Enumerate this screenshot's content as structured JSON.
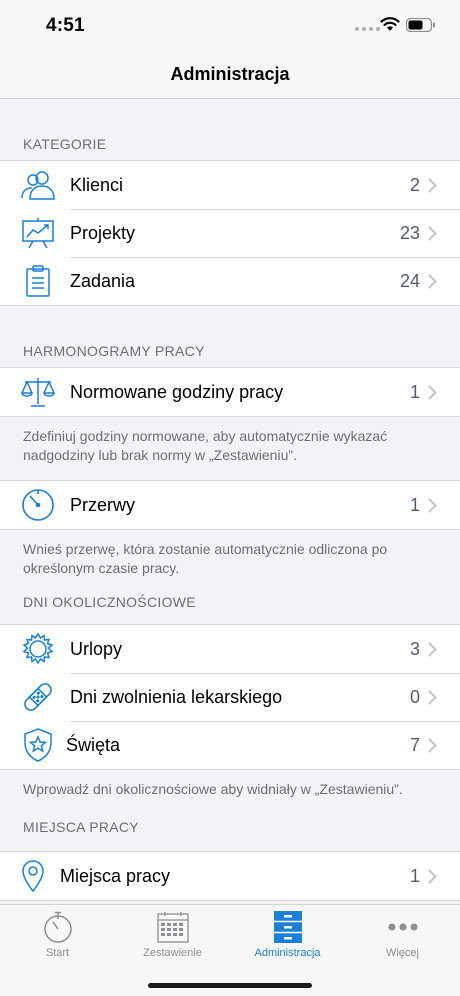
{
  "status_bar": {
    "time": "4:51"
  },
  "nav": {
    "title": "Administracja"
  },
  "sections": {
    "kategorie": {
      "header": "KATEGORIE",
      "items": [
        {
          "label": "Klienci",
          "value": "2",
          "icon": "users-icon"
        },
        {
          "label": "Projekty",
          "value": "23",
          "icon": "presentation-chart-icon"
        },
        {
          "label": "Zadania",
          "value": "24",
          "icon": "clipboard-icon"
        }
      ]
    },
    "harmonogramy": {
      "header": "HARMONOGRAMY PRACY",
      "normowane": {
        "label": "Normowane godziny pracy",
        "value": "1",
        "icon": "scales-icon"
      },
      "normowane_footer": "Zdefiniuj godziny normowane, aby automatycznie wykazać nadgodziny lub brak normy w „Zestawieniu”.",
      "przerwy": {
        "label": "Przerwy",
        "value": "1",
        "icon": "timer-icon"
      },
      "przerwy_footer": "Wnieś przerwę, która zostanie automatycznie odliczona po określonym czasie pracy."
    },
    "dni": {
      "header": "DNI OKOLICZNOŚCIOWE",
      "items": [
        {
          "label": "Urlopy",
          "value": "3",
          "icon": "sun-icon"
        },
        {
          "label": "Dni zwolnienia lekarskiego",
          "value": "0",
          "icon": "bandage-icon"
        },
        {
          "label": "Święta",
          "value": "7",
          "icon": "star-shield-icon"
        }
      ],
      "footer": "Wprowadź dni okolicznościowe aby widniały w „Zestawieniu”."
    },
    "miejsca": {
      "header": "MIEJSCA PRACY",
      "items": [
        {
          "label": "Miejsca pracy",
          "value": "1",
          "icon": "location-pin-icon"
        }
      ]
    }
  },
  "tabs": [
    {
      "label": "Start",
      "icon": "stopwatch-icon",
      "active": false
    },
    {
      "label": "Zestawienie",
      "icon": "calendar-icon",
      "active": false
    },
    {
      "label": "Administracja",
      "icon": "cabinet-icon",
      "active": true
    },
    {
      "label": "Więcej",
      "icon": "more-dots-icon",
      "active": false
    }
  ],
  "colors": {
    "accent": "#1a7fd6",
    "value_text": "#4e5d78",
    "inactive_tab": "#8e8e93"
  }
}
